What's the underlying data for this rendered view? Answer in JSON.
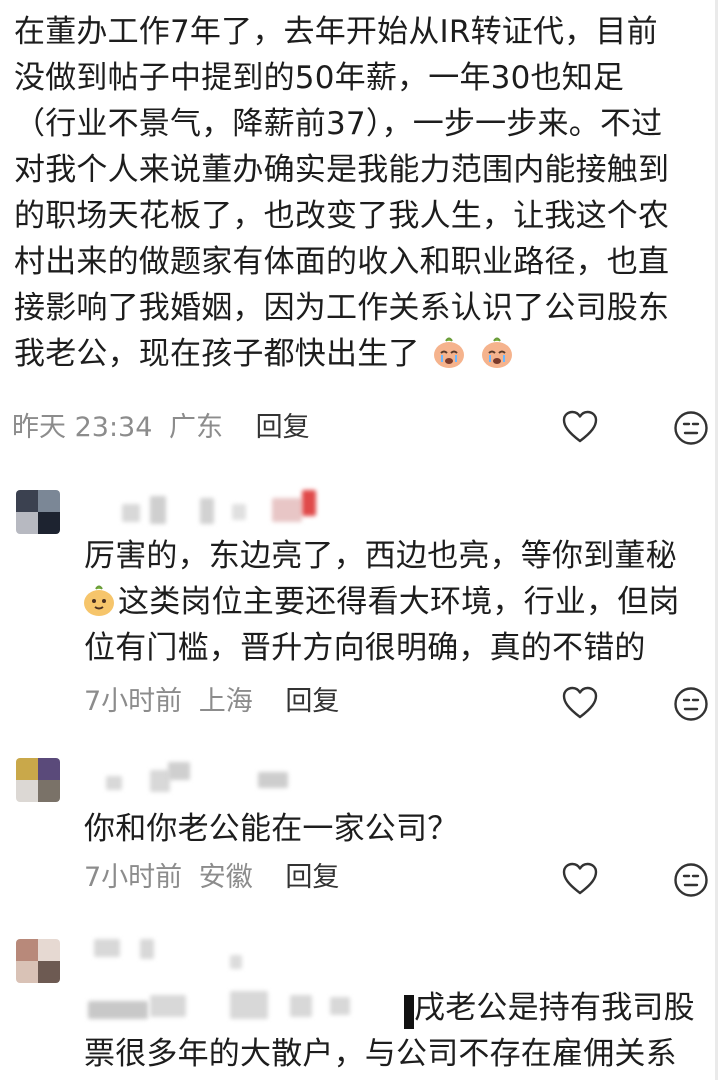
{
  "comments": [
    {
      "lines": [
        "在董办工作7年了，去年开始从IR转证代，目前",
        "没做到帖子中提到的50年薪，一年30也知足",
        "（行业不景气，降薪前37），一步一步来。不过",
        "对我个人来说董办确实是我能力范围内能接触到",
        "的职场天花板了，也改变了我人生，让我这个农",
        "村出来的做题家有体面的收入和职业路径，也直",
        "接影响了我婚姻，因为工作关系认识了公司股东",
        "我老公，现在孩子都快出生了"
      ],
      "time": "昨天 23:34",
      "location": "广东",
      "reply": "回复"
    },
    {
      "lines": [
        "厉害的，东边亮了，西边也亮，等你到董秘",
        "这类岗位主要还得看大环境，行业，但岗",
        "位有门槛，晋升方向很明确，真的不错的"
      ],
      "time": "7小时前",
      "location": "上海",
      "reply": "回复"
    },
    {
      "lines": [
        "你和你老公能在一家公司？"
      ],
      "time": "7小时前",
      "location": "安徽",
      "reply": "回复"
    },
    {
      "lines": [
        "戌老公是持有我司股",
        "票很多年的大散户，与公司不存在雇佣关系"
      ]
    }
  ],
  "icons": {
    "like": "heart-outline-icon",
    "dislike": "neutral-face-icon",
    "emoji": "crying-face-emoji"
  }
}
